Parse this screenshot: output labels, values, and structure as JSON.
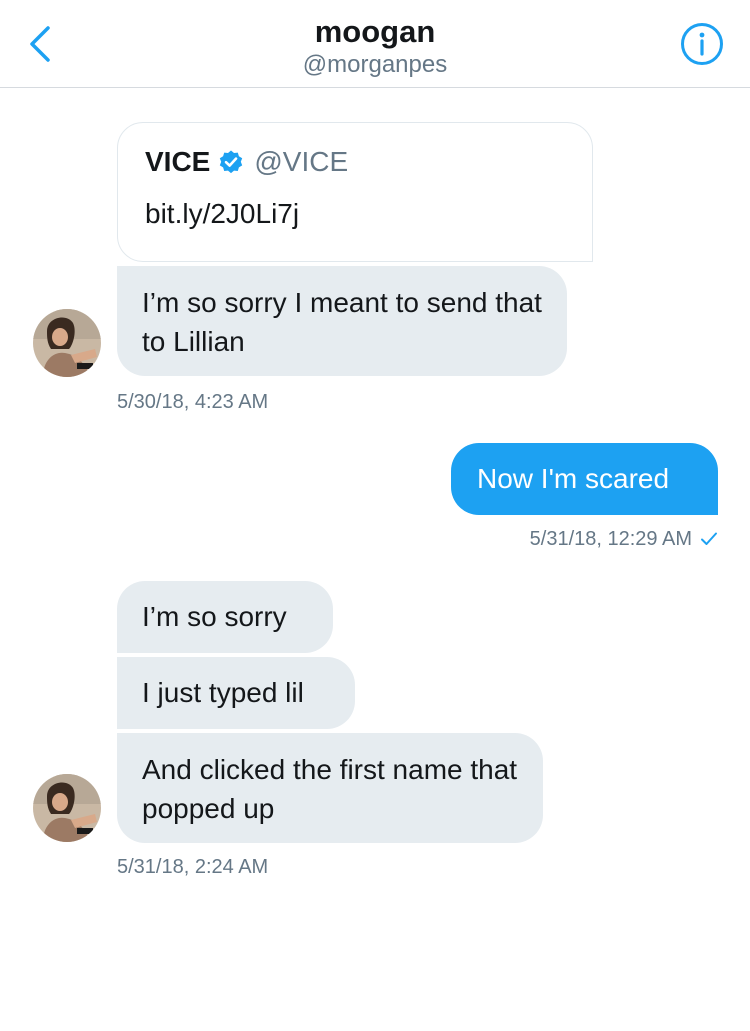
{
  "header": {
    "title": "moogan",
    "subtitle": "@morganpes",
    "back_icon": "chevron-left-icon",
    "info_icon": "info-icon"
  },
  "colors": {
    "accent": "#1da1f2",
    "received_bubble": "#e6ecf0",
    "muted_text": "#657786"
  },
  "messages": {
    "card": {
      "name": "VICE",
      "handle": "@VICE",
      "link": "bit.ly/2J0Li7j",
      "verified_icon": "verified-badge-icon"
    },
    "m1": {
      "text": "I’m so sorry I meant to send that to Lillian",
      "timestamp": "5/30/18, 4:23 AM"
    },
    "m2": {
      "text": "Now I'm scared",
      "timestamp": "5/31/18, 12:29 AM",
      "status_icon": "checkmark-icon"
    },
    "m3": {
      "text": "I’m so sorry"
    },
    "m4": {
      "text": "I just typed lil"
    },
    "m5": {
      "text": "And clicked the first name that popped up",
      "timestamp": "5/31/18, 2:24 AM"
    }
  }
}
